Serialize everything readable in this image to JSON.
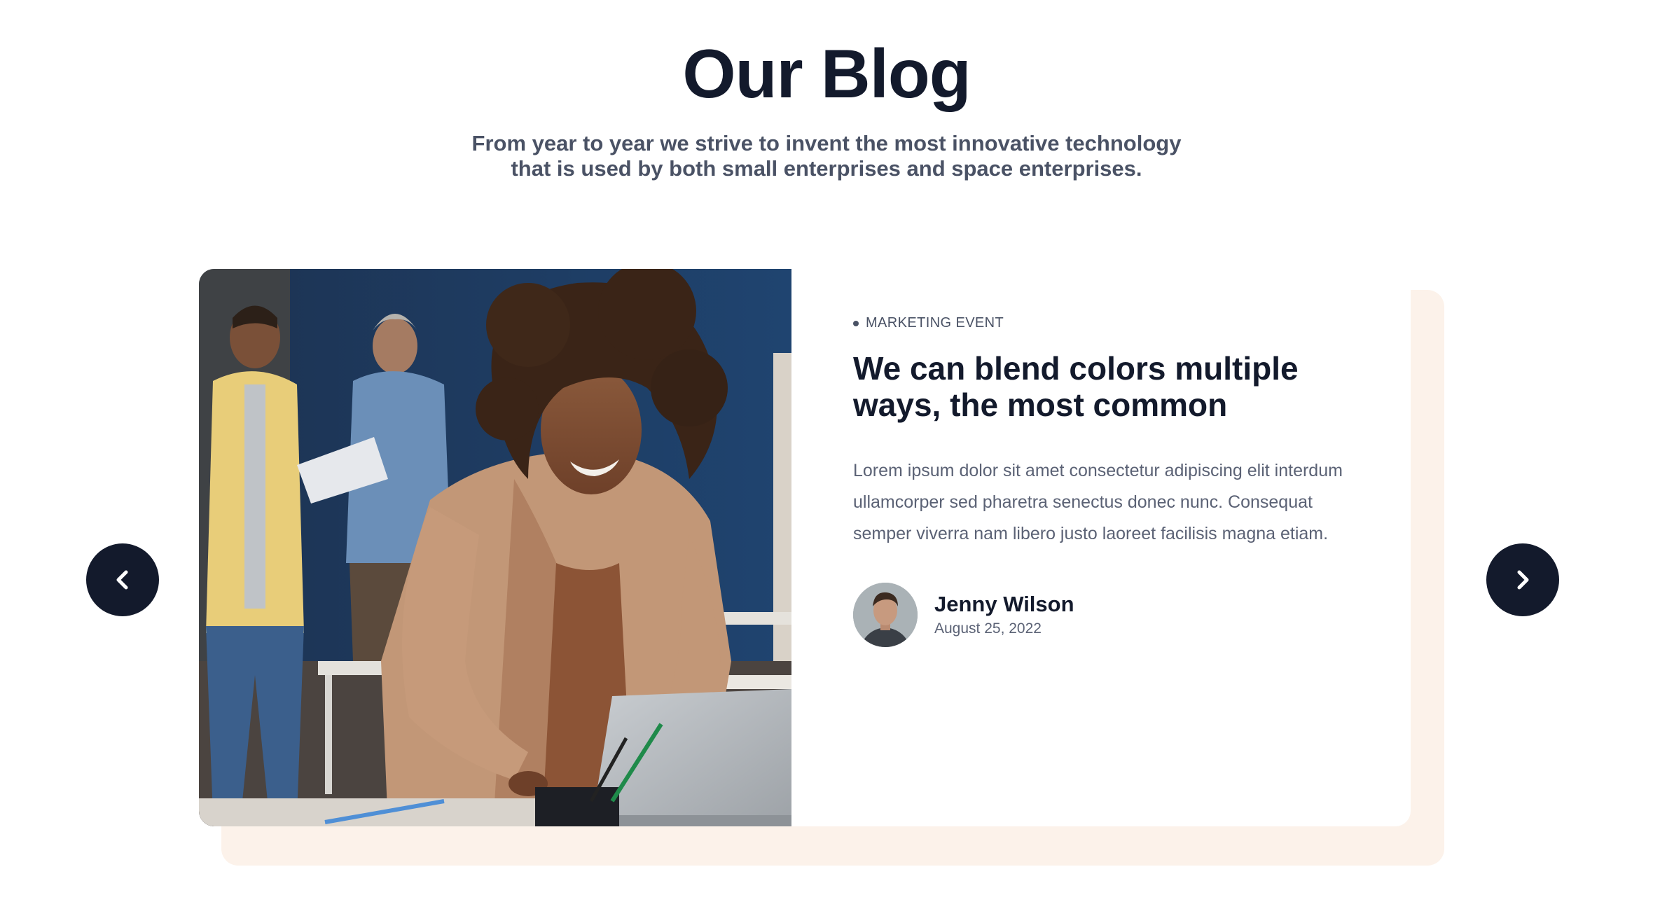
{
  "header": {
    "title": "Our Blog",
    "subtitle_line1": "From year to year we strive to invent the most innovative technology",
    "subtitle_line2": "that is used by both small enterprises and space enterprises."
  },
  "post": {
    "category": "MARKETING EVENT",
    "title": "We can blend colors multiple ways, the most common",
    "excerpt": "Lorem ipsum dolor sit amet consectetur adipiscing elit interdum ullamcorper sed pharetra senectus donec nunc. Consequat semper viverra nam libero justo laoreet facilisis magna etiam.",
    "author": {
      "name": "Jenny Wilson",
      "date": "August 25, 2022"
    }
  },
  "navigation": {
    "prev_icon": "chevron-left-icon",
    "next_icon": "chevron-right-icon"
  },
  "colors": {
    "heading": "#131a2c",
    "body_text": "#4a5265",
    "accent_card_background": "#fcf2ea",
    "button_background": "#131a2c"
  }
}
